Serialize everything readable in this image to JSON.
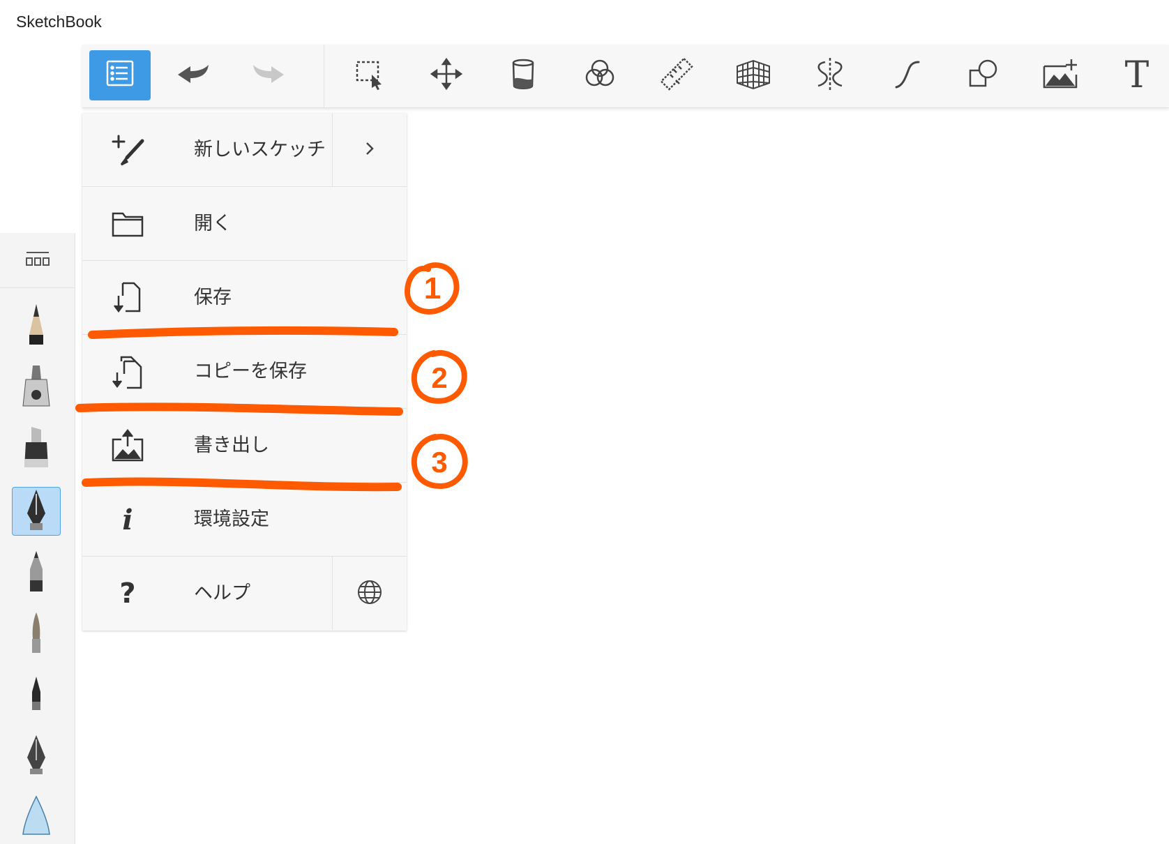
{
  "app": {
    "title": "SketchBook"
  },
  "toolbar": {
    "items": [
      {
        "icon": "menu-list-icon",
        "active": true
      },
      {
        "icon": "undo-icon"
      },
      {
        "icon": "redo-icon"
      },
      {
        "icon": "selection-icon"
      },
      {
        "icon": "move-transform-icon"
      },
      {
        "icon": "paint-bucket-icon"
      },
      {
        "icon": "color-circles-icon"
      },
      {
        "icon": "ruler-icon"
      },
      {
        "icon": "perspective-grid-icon"
      },
      {
        "icon": "symmetry-icon"
      },
      {
        "icon": "curve-stroke-icon"
      },
      {
        "icon": "shapes-icon"
      },
      {
        "icon": "add-image-icon"
      },
      {
        "icon": "text-icon",
        "glyph": "T"
      }
    ]
  },
  "menu": {
    "items": [
      {
        "label": "新しいスケッチ",
        "icon": "new-sketch-icon"
      },
      {
        "label": "開く",
        "icon": "folder-icon"
      },
      {
        "label": "保存",
        "icon": "save-icon"
      },
      {
        "label": "コピーを保存",
        "icon": "save-copy-icon"
      },
      {
        "label": "書き出し",
        "icon": "export-icon"
      },
      {
        "label": "環境設定",
        "icon": "info-icon",
        "glyph": "i"
      },
      {
        "label": "ヘルプ",
        "icon": "help-icon",
        "glyph": "?"
      }
    ]
  },
  "annotations": {
    "color": "#ff5a00",
    "markers": [
      "1",
      "2",
      "3"
    ]
  },
  "brushes": [
    "pencil-brush-icon",
    "airbrush-icon",
    "marker-brush-icon",
    "ink-pen-brush-icon",
    "ballpoint-brush-icon",
    "paintbrush-icon",
    "felt-tip-brush-icon",
    "fountain-pen-brush-icon",
    "eraser-brush-icon"
  ],
  "selected_brush": "ink-pen-brush-icon"
}
